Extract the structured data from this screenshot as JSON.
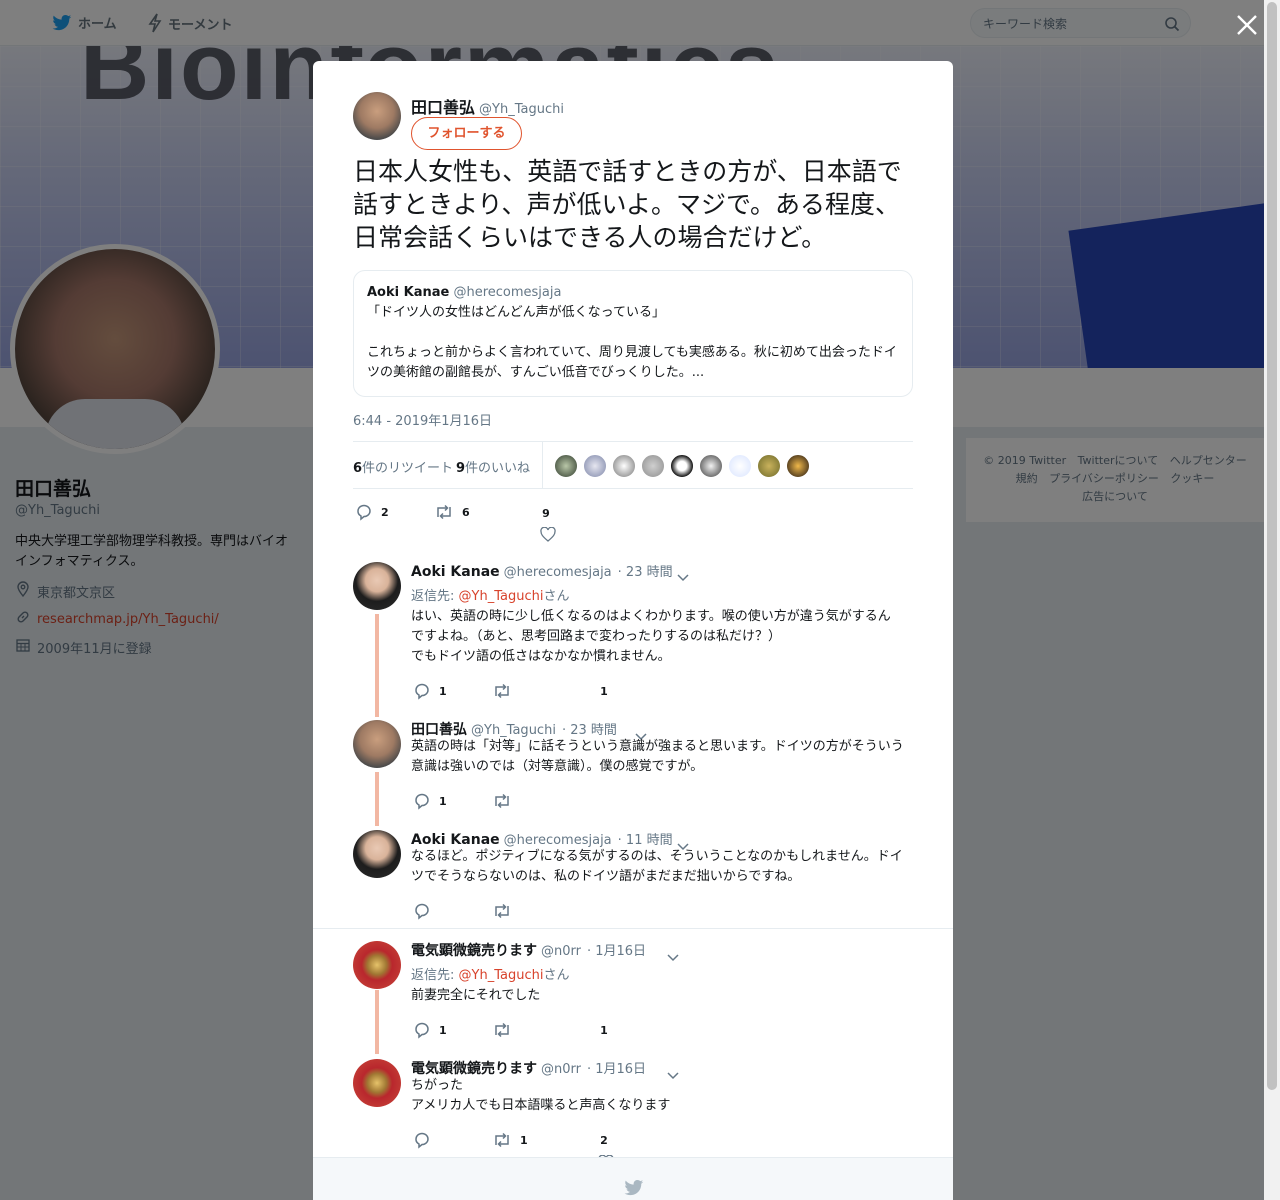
{
  "topnav": {
    "home": "ホーム",
    "moments": "モーメント",
    "search_placeholder": "キーワード検索"
  },
  "banner": {
    "word": "Bioinformatics"
  },
  "profile": {
    "name": "田口善弘",
    "handle": "@Yh_Taguchi",
    "bio": "中央大学理工学部物理学科教授。専門はバイオインフォマティクス。",
    "location": "東京都文京区",
    "url": "researchmap.jp/Yh_Taguchi/",
    "joined": "2009年11月に登録"
  },
  "footer": {
    "links": [
      "© 2019 Twitter",
      "Twitterについて",
      "ヘルプセンター",
      "規約",
      "プライバシーポリシー",
      "クッキー",
      "広告について"
    ]
  },
  "tweet": {
    "name": "田口善弘",
    "handle": "@Yh_Taguchi",
    "follow_label": "フォローする",
    "text": "日本人女性も、英語で話すときの方が、日本語で話すときより、声が低いよ。マジで。ある程度、日常会話くらいはできる人の場合だけど。",
    "quote": {
      "name": "Aoki Kanae",
      "handle": "@herecomesjaja",
      "line1": "「ドイツ人の女性はどんどん声が低くなっている」",
      "line2": "これちょっと前からよく言われていて、周り見渡しても実感ある。秋に初めて出会ったドイ",
      "line3": "ツの美術館の副館長が、すんごい低音でびっくりした。..."
    },
    "time": "6:44 - 2019年1月16日",
    "retweets_count": "6",
    "retweets_label": "件のリツイート",
    "likes_count": "9",
    "likes_label": "件のいいね",
    "actions": {
      "replies": "2",
      "retweets": "6",
      "likes": "9"
    }
  },
  "replies": [
    {
      "name": "Aoki Kanae",
      "handle": "@herecomesjaja",
      "time": "· 23 時間",
      "reply_to_prefix": "返信先: ",
      "reply_to": "@Yh_Taguchi",
      "reply_to_suffix": "さん",
      "line1": "はい、英語の時に少し低くなるのはよくわかります。喉の使い方が違う気がするん",
      "line2": "ですよね。（あと、思考回路まで変わったりするのは私だけ？）",
      "line3": "でもドイツ語の低さはなかなか慣れません。",
      "replies": "1",
      "likes": "1"
    },
    {
      "name": "田口善弘",
      "handle": "@Yh_Taguchi",
      "time": "· 23 時間",
      "line1": "英語の時は「対等」に話そうという意識が強まると思います。ドイツの方がそういう",
      "line2": "意識は強いのでは（対等意識）。僕の感覚ですが。",
      "replies": "1"
    },
    {
      "name": "Aoki Kanae",
      "handle": "@herecomesjaja",
      "time": "· 11 時間",
      "line1": "なるほど。ポジティブになる気がするのは、そういうことなのかもしれません。ドイ",
      "line2": "ツでそうならないのは、私のドイツ語がまだまだ拙いからですね。"
    },
    {
      "name": "電気顕微鏡売ります",
      "handle": "@n0rr",
      "time": "· 1月16日",
      "reply_to_prefix": "返信先: ",
      "reply_to": "@Yh_Taguchi",
      "reply_to_suffix": "さん",
      "line1": "前妻完全にそれでした",
      "replies": "1",
      "likes": "1"
    },
    {
      "name": "電気顕微鏡売ります",
      "handle": "@n0rr",
      "time": "· 1月16日",
      "line1": "ちがった",
      "line2": "アメリカ人でも日本語喋ると声高くなります",
      "retweets": "1",
      "likes": "2"
    }
  ],
  "colors": {
    "accent": "#e0542e",
    "thread": "#f2b7a3"
  }
}
